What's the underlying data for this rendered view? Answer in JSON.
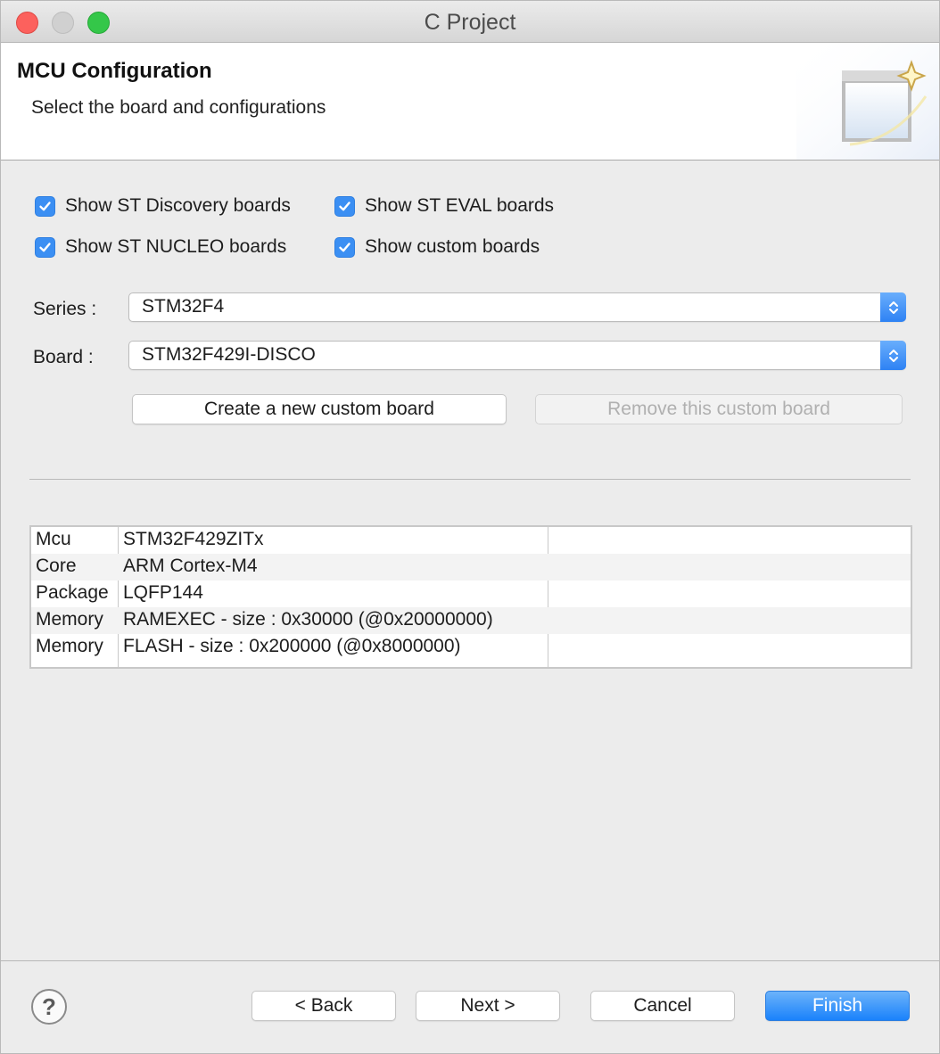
{
  "window": {
    "title": "C Project"
  },
  "header": {
    "title": "MCU Configuration",
    "subtitle": "Select the board and configurations"
  },
  "filters": {
    "discovery": {
      "label": "Show ST Discovery boards",
      "checked": true
    },
    "eval": {
      "label": "Show ST EVAL boards",
      "checked": true
    },
    "nucleo": {
      "label": "Show ST NUCLEO boards",
      "checked": true
    },
    "custom": {
      "label": "Show custom boards",
      "checked": true
    }
  },
  "series": {
    "label": "Series :",
    "value": "STM32F4"
  },
  "board": {
    "label": "Board :",
    "value": "STM32F429I-DISCO"
  },
  "board_actions": {
    "create": "Create a new custom board",
    "remove": "Remove this custom board"
  },
  "details": [
    {
      "key": "Mcu",
      "value": "STM32F429ZITx"
    },
    {
      "key": "Core",
      "value": "ARM Cortex-M4"
    },
    {
      "key": "Package",
      "value": "LQFP144"
    },
    {
      "key": "Memory",
      "value": "RAMEXEC - size : 0x30000 (@0x20000000)"
    },
    {
      "key": "Memory",
      "value": "FLASH - size : 0x200000 (@0x8000000)"
    }
  ],
  "footer": {
    "help": "?",
    "back": "< Back",
    "next": "Next >",
    "cancel": "Cancel",
    "finish": "Finish"
  },
  "colors": {
    "accent": "#3b8ff3",
    "primary_button": "#1a82fb"
  }
}
